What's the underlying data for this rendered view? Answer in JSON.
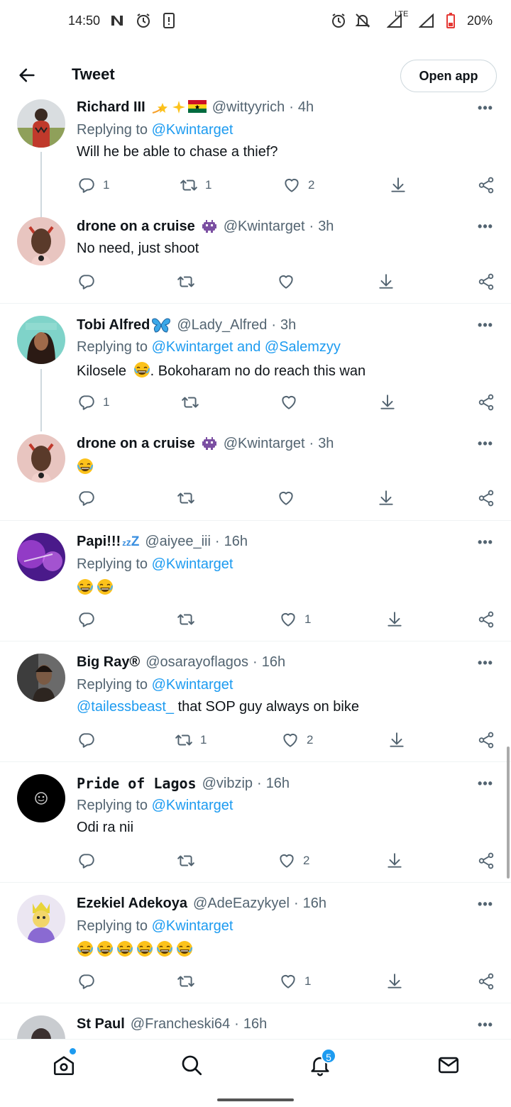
{
  "status_bar": {
    "time": "14:50",
    "network": "LTE",
    "battery": "20%",
    "icons": [
      "n-icon",
      "alarm-icon",
      "phone-icon",
      "alarm-icon",
      "mute-icon",
      "signal-icon",
      "battery-icon"
    ]
  },
  "header": {
    "title": "Tweet",
    "open_app_label": "Open app"
  },
  "tweets": [
    {
      "name": "Richard III",
      "handle": "@wittyyrich",
      "time": "4h",
      "replying_to": "Replying to",
      "mentions": "@Kwintarget",
      "text": "Will he be able to chase a thief?",
      "replies": "1",
      "retweets": "1",
      "likes": "2"
    },
    {
      "name": "drone on a cruise",
      "handle": "@Kwintarget",
      "time": "3h",
      "text": "No need, just shoot",
      "replies": "",
      "retweets": "",
      "likes": ""
    },
    {
      "name": "Tobi Alfred",
      "handle": "@Lady_Alfred",
      "time": "3h",
      "replying_to": "Replying to",
      "mentions": "@Kwintarget and @Salemzyy",
      "text_before": "Kilosele",
      "text_after": ". Bokoharam no do reach this wan",
      "replies": "1",
      "retweets": "",
      "likes": ""
    },
    {
      "name": "drone on a cruise",
      "handle": "@Kwintarget",
      "time": "3h",
      "replies": "",
      "retweets": "",
      "likes": ""
    },
    {
      "name": "Papi!!!",
      "handle": "@aiyee_iii",
      "time": "16h",
      "replying_to": "Replying to",
      "mentions": "@Kwintarget",
      "replies": "",
      "retweets": "",
      "likes": "1"
    },
    {
      "name": "Big Ray®",
      "handle": "@osarayoflagos",
      "time": "16h",
      "replying_to": "Replying to",
      "mentions": "@Kwintarget",
      "text_link": "@tailessbeast_",
      "text": " that SOP guy always on bike",
      "replies": "",
      "retweets": "1",
      "likes": "2"
    },
    {
      "name": "Pride of Lagos",
      "handle": "@vibzip",
      "time": "16h",
      "replying_to": "Replying to",
      "mentions": "@Kwintarget",
      "text": "Odi ra nii",
      "replies": "",
      "retweets": "",
      "likes": "2"
    },
    {
      "name": "Ezekiel Adekoya",
      "handle": "@AdeEazykyel",
      "time": "16h",
      "replying_to": "Replying to",
      "mentions": "@Kwintarget",
      "replies": "",
      "retweets": "",
      "likes": "1"
    },
    {
      "name": "St Paul",
      "handle": "@Francheski64",
      "time": "16h"
    }
  ],
  "bottom_nav": {
    "notifications_badge": "5",
    "items": [
      "home-icon",
      "search-icon",
      "notifications-icon",
      "messages-icon"
    ]
  },
  "colors": {
    "accent": "#1d9bf0",
    "text": "#0f1419",
    "secondary": "#536471",
    "divider": "#eff3f4"
  }
}
